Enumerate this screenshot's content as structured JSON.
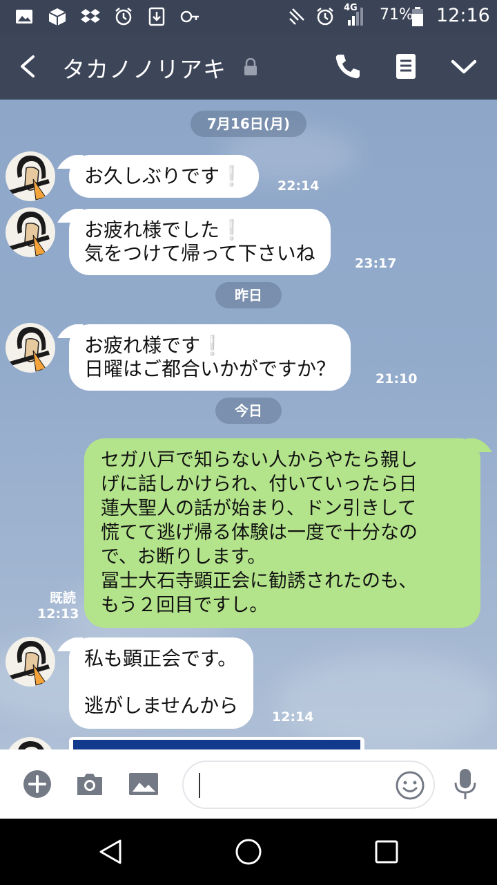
{
  "status_bar": {
    "battery": "71%",
    "time": "12:16",
    "network": "4G",
    "left_icons": [
      "gallery-icon",
      "package-icon",
      "dropbox-icon",
      "alarm-icon",
      "download-icon",
      "key-icon"
    ],
    "right_icons": [
      "nfc-icon",
      "alarm-icon",
      "signal-icon",
      "battery-icon"
    ]
  },
  "header": {
    "contact_name": "タカノノリアキ",
    "icons": [
      "back-icon",
      "lock-icon",
      "call-icon",
      "notes-icon",
      "chevron-down-icon"
    ]
  },
  "chat": {
    "date_dividers": [
      "7月16日(月)",
      "昨日",
      "今日"
    ],
    "messages": [
      {
        "side": "in",
        "lines": [
          "お久しぶりです"
        ],
        "excl": [
          true
        ],
        "time": "22:14"
      },
      {
        "side": "in",
        "lines": [
          "お疲れ様でした",
          "気をつけて帰って下さいね"
        ],
        "excl": [
          true,
          false
        ],
        "time": "23:17"
      },
      {
        "side": "in",
        "lines": [
          "お疲れ様です",
          "日曜はご都合いかがですか？"
        ],
        "excl": [
          true,
          false
        ],
        "time": "21:10"
      },
      {
        "side": "out",
        "lines": [
          "セガ八戸で知らない人からやたら親し",
          "げに話しかけられ、付いていったら日",
          "蓮大聖人の話が始まり、ドン引きして",
          "慌てて逃げ帰る体験は一度で十分なの",
          "で、お断りします。",
          "冨士大石寺顕正会に勧誘されたのも、",
          "もう２回目ですし。"
        ],
        "read_label": "既読",
        "time": "12:13"
      },
      {
        "side": "in",
        "lines": [
          "私も顕正会です。",
          "",
          "逃がしませんから"
        ],
        "time": "12:14"
      }
    ],
    "exclamation": "❕"
  },
  "input_bar": {
    "icons": [
      "add-icon",
      "camera-icon",
      "image-icon",
      "emoji-icon",
      "microphone-icon"
    ],
    "placeholder": ""
  },
  "nav_bar": {
    "icons": [
      "back-triangle-icon",
      "home-icon",
      "recents-icon"
    ]
  },
  "colors": {
    "header_bg": "#3d4559",
    "chat_bg": "#93abcb",
    "bubble_in": "#ffffff",
    "bubble_out": "#b3e38a",
    "exclamation": "#25b0e6"
  }
}
